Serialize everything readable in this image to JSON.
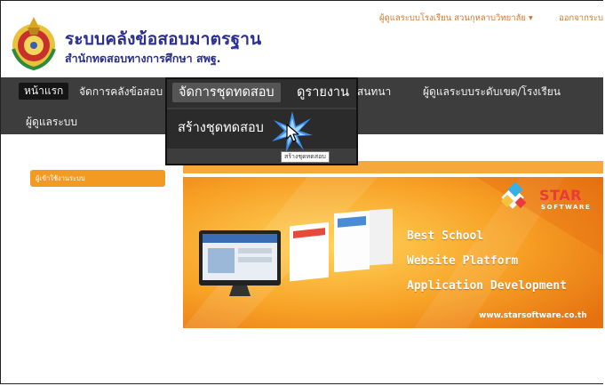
{
  "header": {
    "site_title": "ระบบคลังข้อสอบมาตรฐาน",
    "site_subtitle": "สำนักทดสอบทางการศึกษา สพฐ.",
    "user_menu": "ผู้ดูแลระบบโรงเรียน สวนกุหลาบวิทยาลัย ▾",
    "logout": "ออกจากระบ"
  },
  "nav": {
    "home": "หน้าแรก",
    "manage_bank": "จัดการคลังข้อสอบ",
    "manage_test_sets": "จัดการชุดทดสอบ",
    "reports": "ดูรายงาน",
    "forum": "กระดานสนทนา",
    "district_admin": "ผู้ดูแลระบบระดับเขต/โรงเรียน",
    "system_admin": "ผู้ดูแลระบบ"
  },
  "dropdown": {
    "create_test_set": "สร้างชุดทดสอบ"
  },
  "tooltip": "สร้างชุดทดสอบ",
  "sidebar": {
    "login_users": "ผู้เข้าใช้งานระบบ"
  },
  "banner": {
    "brand": "STAR",
    "brand_sub": "SOFTWARE",
    "line1": "Best School",
    "line2": "Website Platform",
    "line3": "Application Development",
    "url": "www.starsoftware.co.th"
  },
  "colors": {
    "accent_orange": "#f39a22",
    "nav_dark": "#3d3d3d",
    "title_blue": "#2b2f8f",
    "link_orange": "#d9772a"
  }
}
